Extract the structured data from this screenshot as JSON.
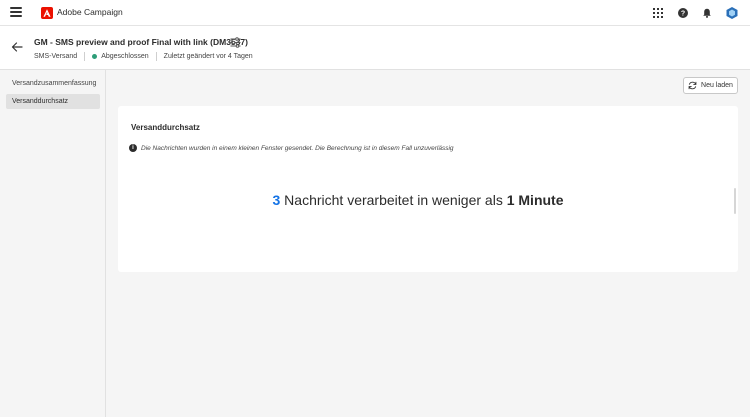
{
  "app": {
    "title": "Adobe Campaign"
  },
  "header": {
    "title": "GM - SMS preview and proof Final with link (DM3537)",
    "channel": "SMS-Versand",
    "status": "Abgeschlossen",
    "modified": "Zuletzt geändert vor 4 Tagen"
  },
  "sidebar": {
    "items": [
      {
        "label": "Versandzusammenfassung",
        "active": false
      },
      {
        "label": "Versanddurchsatz",
        "active": true
      }
    ]
  },
  "toolbar": {
    "reload_label": "Neu laden"
  },
  "card": {
    "title": "Versanddurchsatz",
    "info": "Die Nachrichten wurden in einem kleinen Fenster gesendet. Die Berechnung ist in diesem Fall unzuverlässig",
    "metric": {
      "count": "3",
      "text": " Nachricht verarbeitet in weniger als ",
      "duration": "1 Minute"
    }
  },
  "colors": {
    "accent": "#1473e6",
    "status_success": "#2d9d78",
    "adobe_red": "#eb1000"
  },
  "icons": {
    "menu": "hamburger-icon",
    "apps": "apps-grid-icon",
    "help": "help-icon",
    "notifications": "bell-icon",
    "profile": "org-avatar-icon",
    "back": "arrow-left-icon",
    "settings": "sliders-icon",
    "reload": "refresh-icon",
    "info": "info-icon"
  }
}
